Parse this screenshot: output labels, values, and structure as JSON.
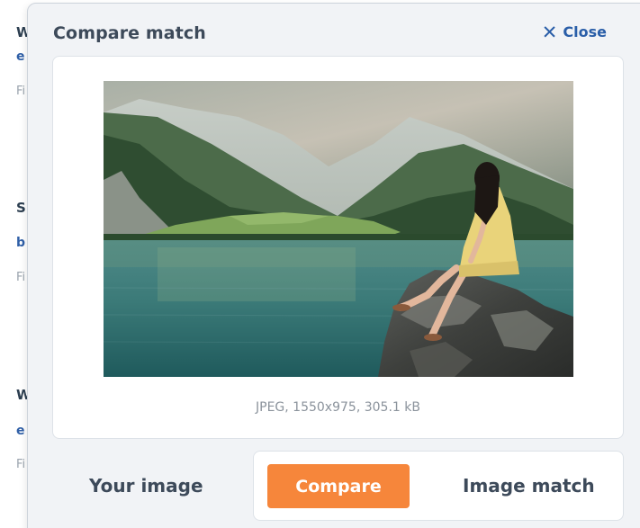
{
  "background_page": {
    "fragments": [
      {
        "text": "W",
        "style": "head"
      },
      {
        "text": "e",
        "style": "link"
      },
      {
        "text": "Fi",
        "style": "meta"
      },
      {
        "text": "S",
        "style": "head"
      },
      {
        "text": "b",
        "style": "link"
      },
      {
        "text": "Fi",
        "style": "meta"
      },
      {
        "text": "W",
        "style": "head"
      },
      {
        "text": "e",
        "style": "link"
      },
      {
        "text": "Fi",
        "style": "meta"
      }
    ]
  },
  "modal": {
    "title": "Compare match",
    "close_label": "Close",
    "close_icon": "close-x-icon",
    "image_caption": "JPEG, 1550x975, 305.1 kB",
    "your_image_label": "Your image",
    "compare_label": "Compare",
    "image_match_label": "Image match"
  },
  "colors": {
    "accent_orange": "#f6863b",
    "link_blue": "#2a5ea8",
    "heading": "#3d4a5a",
    "panel_bg": "#f1f3f6"
  }
}
